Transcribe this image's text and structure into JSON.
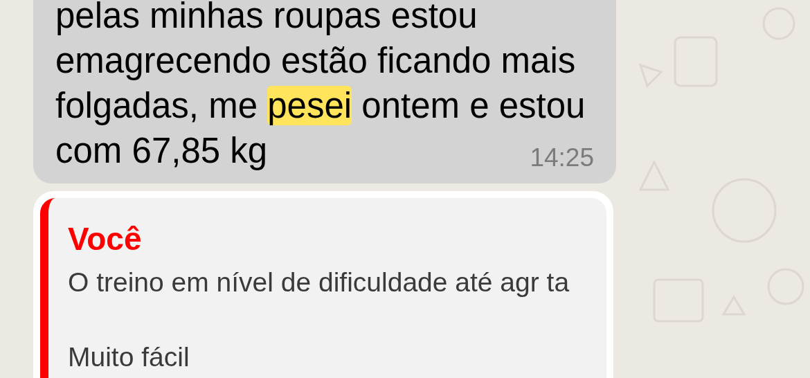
{
  "message": {
    "segments": [
      {
        "text": "pelas minhas roupas estou\nemagrecendo estão ficando mais\nfolgadas, me ",
        "highlighted": false
      },
      {
        "text": "pesei",
        "highlighted": true
      },
      {
        "text": " ontem e estou\ncom 67,85 kg",
        "highlighted": false
      }
    ],
    "time": "14:25"
  },
  "reply": {
    "quoted_author": "Você",
    "quoted_text": "O treino em nível de dificuldade até agr ta\n\nMuito fácil"
  }
}
